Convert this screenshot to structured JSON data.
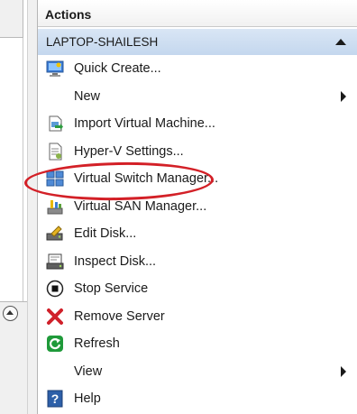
{
  "actions_pane": {
    "title": "Actions",
    "server": {
      "name": "LAPTOP-SHAILESH",
      "items": [
        {
          "label": "Quick Create...",
          "icon": "quick-create-icon",
          "submenu": false
        },
        {
          "label": "New",
          "icon": "",
          "submenu": true
        },
        {
          "label": "Import Virtual Machine...",
          "icon": "import-vm-icon",
          "submenu": false
        },
        {
          "label": "Hyper-V Settings...",
          "icon": "hyperv-settings-icon",
          "submenu": false
        },
        {
          "label": "Virtual Switch Manager...",
          "icon": "virtual-switch-icon",
          "submenu": false
        },
        {
          "label": "Virtual SAN Manager...",
          "icon": "virtual-san-icon",
          "submenu": false
        },
        {
          "label": "Edit Disk...",
          "icon": "edit-disk-icon",
          "submenu": false
        },
        {
          "label": "Inspect Disk...",
          "icon": "inspect-disk-icon",
          "submenu": false
        },
        {
          "label": "Stop Service",
          "icon": "stop-service-icon",
          "submenu": false
        },
        {
          "label": "Remove Server",
          "icon": "remove-server-icon",
          "submenu": false
        },
        {
          "label": "Refresh",
          "icon": "refresh-icon",
          "submenu": false
        },
        {
          "label": "View",
          "icon": "",
          "submenu": true
        },
        {
          "label": "Help",
          "icon": "help-icon",
          "submenu": false
        }
      ]
    }
  },
  "annotation": {
    "target": "Virtual Switch Manager...",
    "color": "#d32027"
  },
  "colors": {
    "header_bg": "#c4d7ee",
    "remove_red": "#d0202a",
    "refresh_green": "#1f9a3a",
    "help_blue": "#2d5fa8"
  }
}
